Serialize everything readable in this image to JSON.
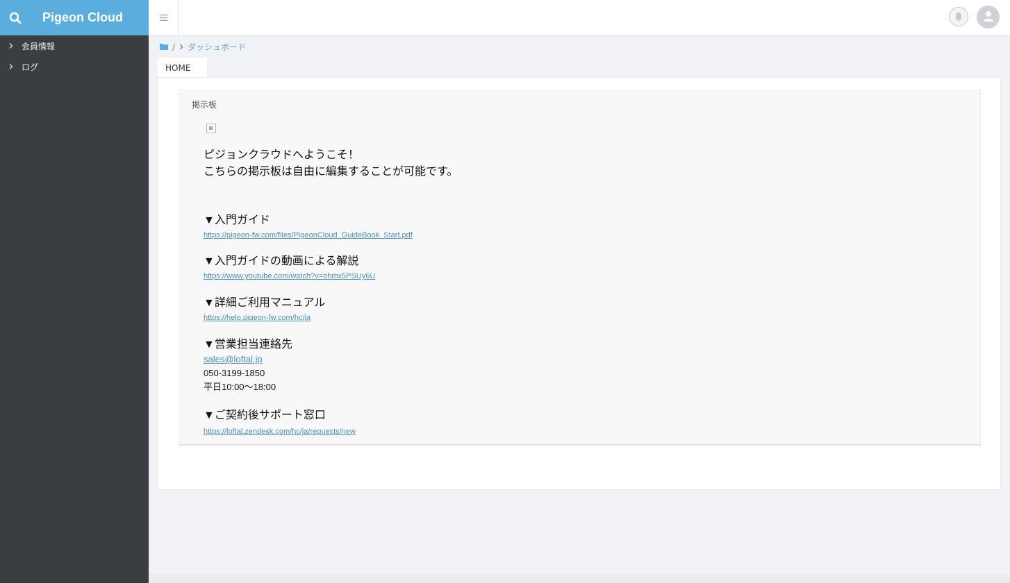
{
  "app": {
    "title": "Pigeon Cloud"
  },
  "sidebar": {
    "items": [
      {
        "label": "会員情報"
      },
      {
        "label": "ログ"
      }
    ]
  },
  "breadcrumb": {
    "separator": "/",
    "current": "ダッシュボード"
  },
  "tabs": [
    {
      "label": "HOME"
    }
  ],
  "board": {
    "title": "掲示板",
    "welcome_line1": "ピジョンクラウドへようこそ！",
    "welcome_line2": "こちらの掲示板は自由に編集することが可能です。",
    "sections": [
      {
        "heading": "▼入門ガイド",
        "link": "https://pigeon-fw.com/files/PigeonCloud_GuideBook_Start.pdf"
      },
      {
        "heading": "▼入門ガイドの動画による解説",
        "link": "https://www.youtube.com/watch?v=ohmx5PSUy6U"
      },
      {
        "heading": "▼詳細ご利用マニュアル",
        "link": "https://help.pigeon-fw.com/hc/ja"
      },
      {
        "heading": "▼営業担当連絡先",
        "email": "sales@loftal.jp",
        "phone": "050-3199-1850",
        "hours": "平日10:00〜18:00"
      },
      {
        "heading": "▼ご契約後サポート窓口",
        "link": "https://loftal.zendesk.com/hc/ja/requests/new"
      }
    ]
  },
  "icons": {
    "search": "search-icon",
    "menu": "hamburger-icon",
    "bell": "bell-icon",
    "avatar": "user-icon",
    "folder": "folder-icon",
    "chevron": "chevron-right-icon"
  },
  "colors": {
    "brand": "#5aaddd",
    "sidebar": "#3a3e42",
    "link": "#4a90c2"
  }
}
